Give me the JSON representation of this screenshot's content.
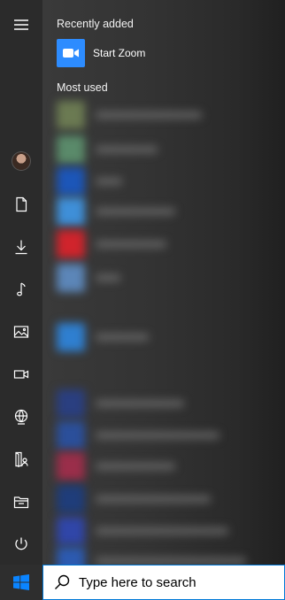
{
  "start_menu": {
    "recently_added_title": "Recently added",
    "recent_app": {
      "label": "Start Zoom",
      "icon": "zoom-icon",
      "tile_color": "#2d8cff"
    },
    "most_used_title": "Most used"
  },
  "sidebar": {
    "items": [
      {
        "name": "hamburger-menu-icon"
      },
      {
        "name": "user-avatar"
      },
      {
        "name": "documents-icon"
      },
      {
        "name": "downloads-icon"
      },
      {
        "name": "music-icon"
      },
      {
        "name": "pictures-icon"
      },
      {
        "name": "videos-icon"
      },
      {
        "name": "network-icon"
      },
      {
        "name": "personal-folder-icon"
      },
      {
        "name": "file-explorer-icon"
      },
      {
        "name": "power-icon"
      }
    ]
  },
  "taskbar": {
    "start_icon": "windows-logo-icon",
    "search_placeholder": "Type here to search",
    "accent": "#0078d7"
  }
}
